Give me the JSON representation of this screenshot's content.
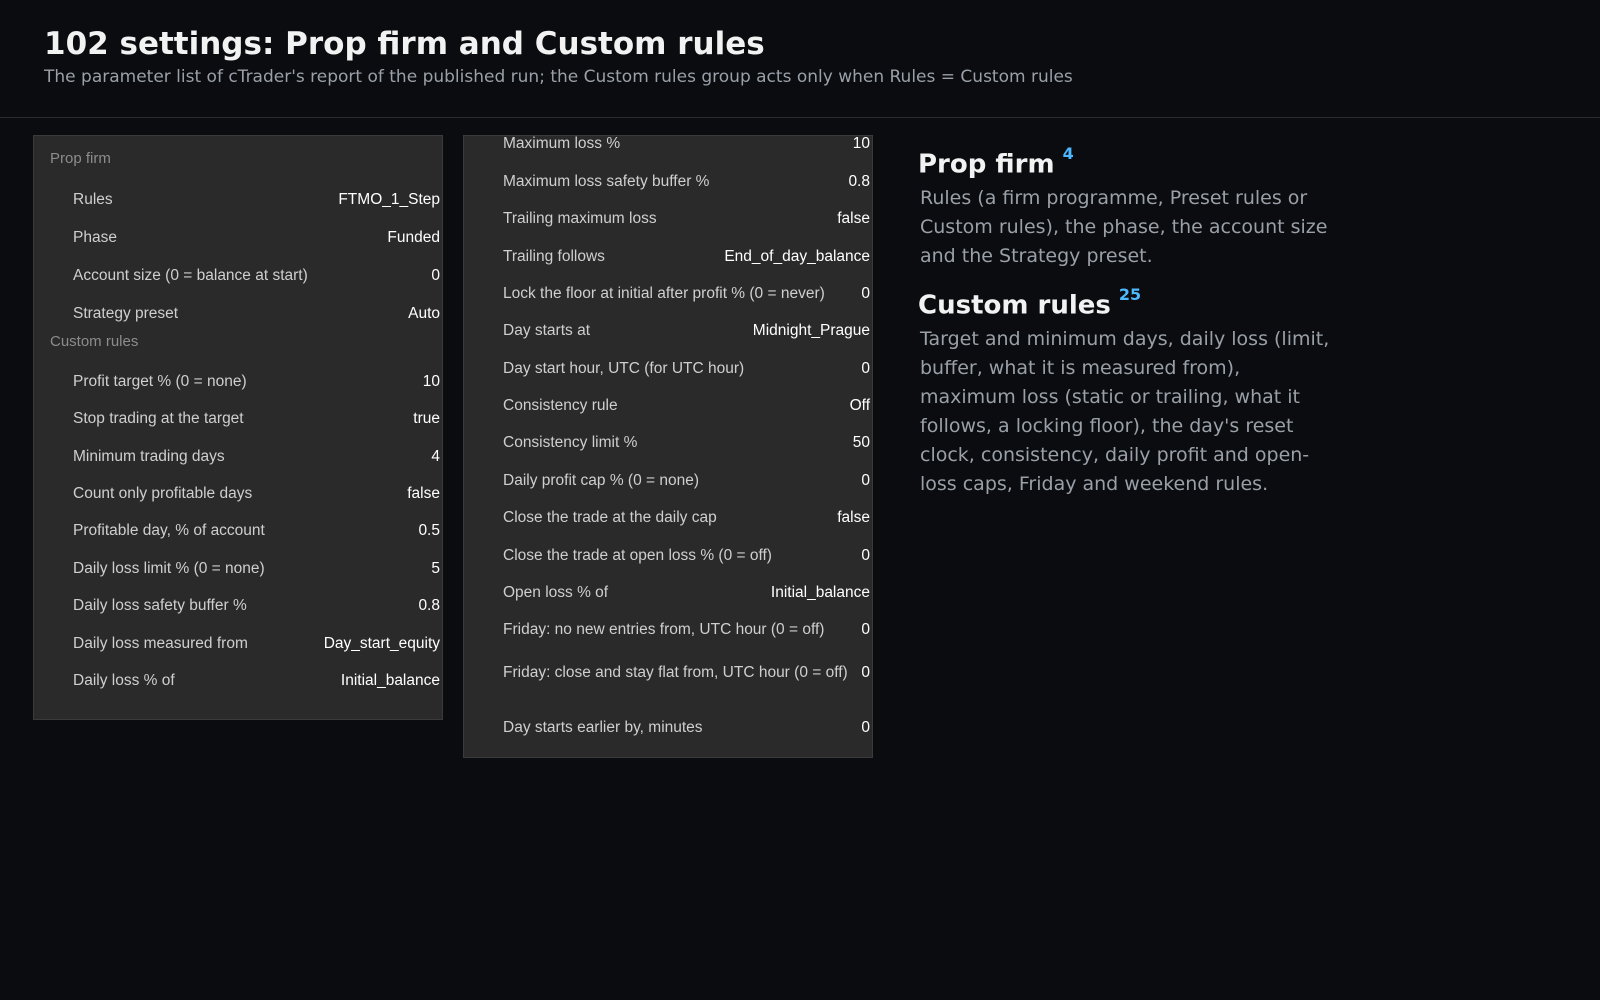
{
  "header": {
    "title": "102 settings: Prop firm and Custom rules",
    "subtitle": "The parameter list of cTrader's report of the published run; the Custom rules group acts only when Rules = Custom rules"
  },
  "left_panel": {
    "prop_firm_label": "Prop firm",
    "prop_firm_rows": [
      {
        "label": "Rules",
        "value": "FTMO_1_Step"
      },
      {
        "label": "Phase",
        "value": "Funded"
      },
      {
        "label": "Account size (0 = balance at start)",
        "value": "0"
      },
      {
        "label": "Strategy preset",
        "value": "Auto"
      }
    ],
    "custom_rules_label": "Custom rules",
    "custom_rows": [
      {
        "label": "Profit target % (0 = none)",
        "value": "10"
      },
      {
        "label": "Stop trading at the target",
        "value": "true"
      },
      {
        "label": "Minimum trading days",
        "value": "4"
      },
      {
        "label": "Count only profitable days",
        "value": "false"
      },
      {
        "label": "Profitable day, % of account",
        "value": "0.5"
      },
      {
        "label": "Daily loss limit % (0 = none)",
        "value": "5"
      },
      {
        "label": "Daily loss safety buffer %",
        "value": "0.8"
      },
      {
        "label": "Daily loss measured from",
        "value": "Day_start_equity"
      },
      {
        "label": "Daily loss % of",
        "value": "Initial_balance"
      }
    ]
  },
  "mid_panel": {
    "rows": [
      {
        "label": "Maximum loss %",
        "value": "10"
      },
      {
        "label": "Maximum loss safety buffer %",
        "value": "0.8"
      },
      {
        "label": "Trailing maximum loss",
        "value": "false"
      },
      {
        "label": "Trailing follows",
        "value": "End_of_day_balance"
      },
      {
        "label": "Lock the floor at initial after profit % (0 = never)",
        "value": "0"
      },
      {
        "label": "Day starts at",
        "value": "Midnight_Prague"
      },
      {
        "label": "Day start hour, UTC (for UTC hour)",
        "value": "0"
      },
      {
        "label": "Consistency rule",
        "value": "Off"
      },
      {
        "label": "Consistency limit %",
        "value": "50"
      },
      {
        "label": "Daily profit cap % (0 = none)",
        "value": "0"
      },
      {
        "label": "Close the trade at the daily cap",
        "value": "false"
      },
      {
        "label": "Close the trade at open loss % (0 = off)",
        "value": "0"
      },
      {
        "label": "Open loss % of",
        "value": "Initial_balance"
      },
      {
        "label": "Friday: no new entries from, UTC hour (0 = off)",
        "value": "0"
      },
      {
        "label": "Friday: close and stay flat from, UTC hour (0 = off)",
        "value": "0"
      },
      {
        "label": "Day starts earlier by, minutes",
        "value": "0"
      }
    ]
  },
  "side": {
    "prop_firm": {
      "title": "Prop firm",
      "count": "4",
      "text": "Rules (a firm programme, Preset rules or Custom rules), the phase, the account size and the Strategy preset."
    },
    "custom_rules": {
      "title": "Custom rules",
      "count": "25",
      "text": "Target and minimum days, daily loss (limit, buffer, what it is measured from), maximum loss (static or trailing, what it follows, a locking floor), the day's reset clock, consistency, daily profit and open-loss caps, Friday and weekend rules."
    }
  }
}
